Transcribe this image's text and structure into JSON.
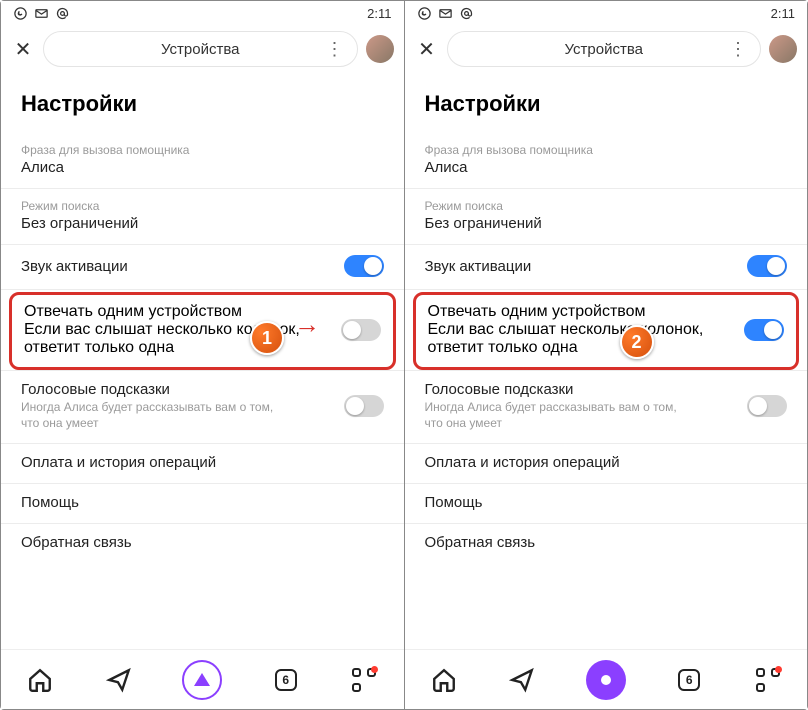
{
  "status": {
    "time": "2:11"
  },
  "nav": {
    "title": "Устройства"
  },
  "page": {
    "heading": "Настройки"
  },
  "rows": {
    "voice_phrase": {
      "label": "Фраза для вызова помощника",
      "value": "Алиса"
    },
    "search_mode": {
      "label": "Режим поиска",
      "value": "Без ограничений"
    },
    "activation_sound": {
      "label": "Звук активации"
    },
    "single_device": {
      "label": "Отвечать одним устройством",
      "sub": "Если вас слышат несколько колонок, ответит только одна"
    },
    "voice_hints": {
      "label": "Голосовые подсказки",
      "sub": "Иногда Алиса будет рассказывать вам о том, что она умеет"
    },
    "payments": {
      "label": "Оплата и история операций"
    },
    "help": {
      "label": "Помощь"
    },
    "feedback": {
      "label": "Обратная связь"
    }
  },
  "badges": {
    "one": "1",
    "two": "2"
  },
  "bottom": {
    "counter": "6"
  }
}
